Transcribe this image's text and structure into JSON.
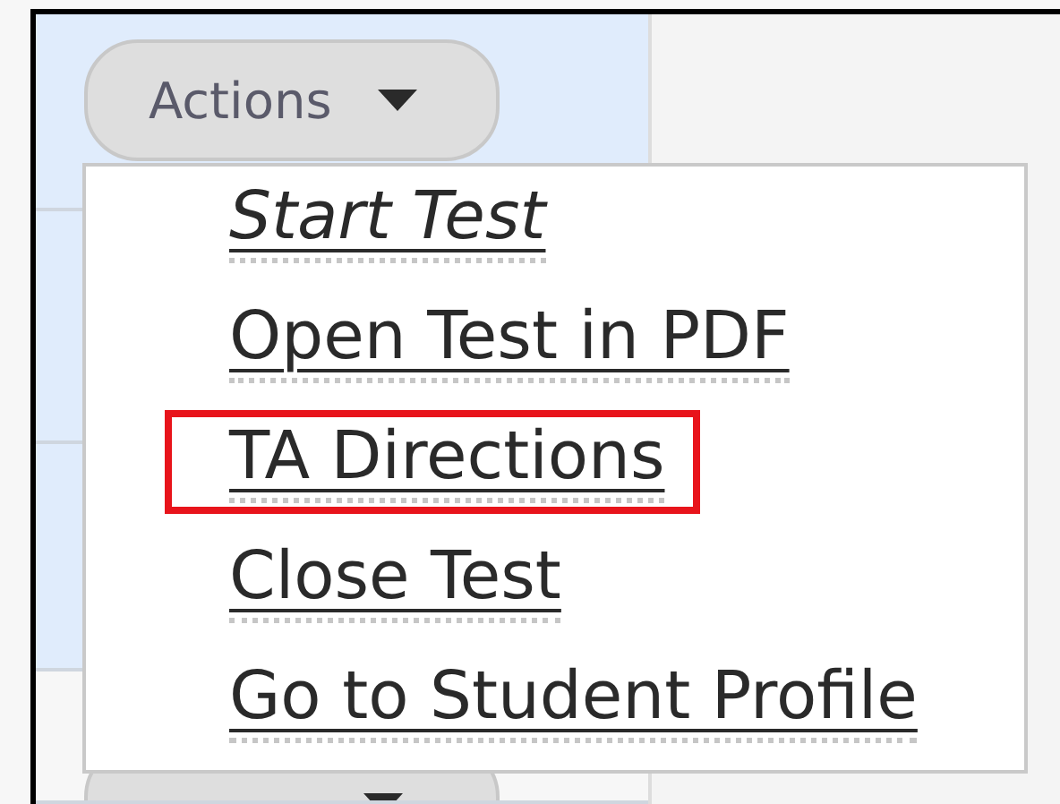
{
  "actions_button": {
    "label": "Actions"
  },
  "menu": {
    "items": [
      {
        "label": "Start Test",
        "kind": "emphasized",
        "highlighted": false
      },
      {
        "label": "Open Test in PDF",
        "kind": "link",
        "highlighted": false
      },
      {
        "label": "TA Directions",
        "kind": "link",
        "highlighted": true
      },
      {
        "label": "Close Test",
        "kind": "link",
        "highlighted": false
      },
      {
        "label": "Go to Student Profile",
        "kind": "link",
        "highlighted": false
      }
    ]
  }
}
